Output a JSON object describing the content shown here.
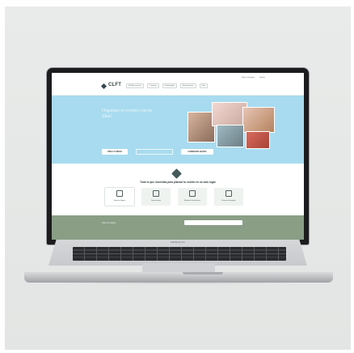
{
  "site": {
    "logo_text": "CLFT",
    "nav": [
      "Wedding venues",
      "Catering",
      "Photography",
      "Entertainment",
      "Gifts"
    ],
    "util": [
      "Meet a designer",
      "Search"
    ]
  },
  "hero": {
    "title": "Organize tu evento con tu Ideal",
    "buttons": [
      "CREA TU MESA",
      "",
      "COMENZAR AHORA"
    ]
  },
  "section": {
    "title": "Todo lo que necesitas para planear tu evento en un solo lugar",
    "cards": [
      "Sitios de lugares",
      "Decoraciones",
      "Mundo de Invitaciones",
      "Favores de regalos"
    ]
  },
  "footer": {
    "text": "Gran de lugares"
  },
  "laptop": {
    "label": "MacBook Pro"
  },
  "colors": {
    "hero_blue": "#a8dbef",
    "footer_green": "#8a9e86",
    "bezel": "#1c1c1e"
  }
}
